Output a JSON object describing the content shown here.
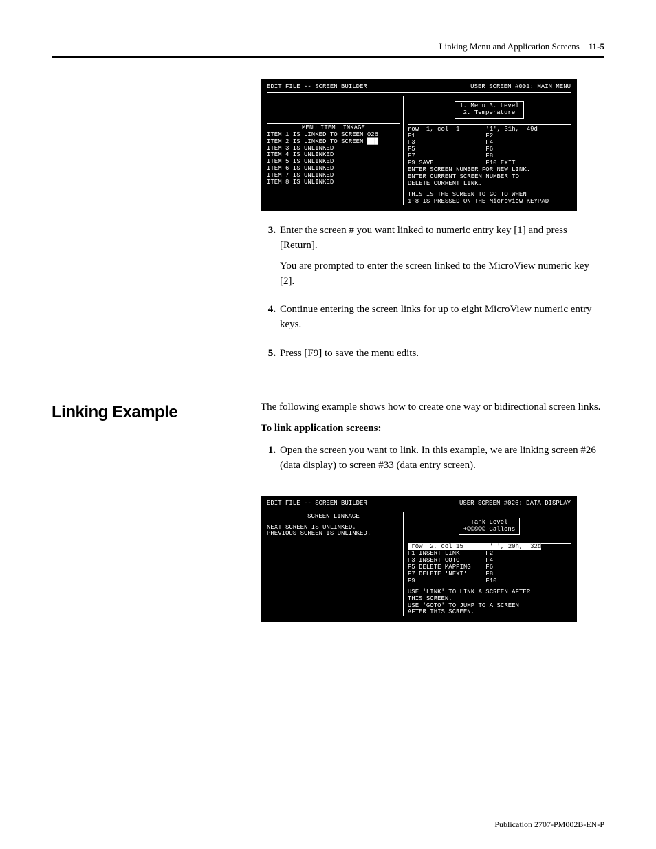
{
  "header": {
    "title": "Linking Menu and Application Screens",
    "page_ref": "11-5"
  },
  "terminal1": {
    "title_left": "EDIT FILE -- SCREEN BUILDER",
    "title_right": "USER SCREEN #001: MAIN MENU",
    "box_l1": "1. Menu 3. Level",
    "box_l2": "2. Temperature",
    "left_heading": "MENU ITEM LINKAGE",
    "left_lines": "ITEM 1 IS LINKED TO SCREEN 026\nITEM 2 IS LINKED TO SCREEN ███\nITEM 3 IS UNLINKED\nITEM 4 IS UNLINKED\nITEM 5 IS UNLINKED\nITEM 6 IS UNLINKED\nITEM 7 IS UNLINKED\nITEM 8 IS UNLINKED",
    "right_status": "row  1, col  1       '1', 31h,  49d",
    "right_fkeys": "F1                   F2\nF3                   F4\nF5                   F6\nF7                   F8\nF9 SAVE              F10 EXIT",
    "right_msg1": "ENTER SCREEN NUMBER FOR NEW LINK.\nENTER CURRENT SCREEN NUMBER TO\nDELETE CURRENT LINK.",
    "right_msg2": "THIS IS THE SCREEN TO GO TO WHEN\n1-8 IS PRESSED ON THE MicroView KEYPAD"
  },
  "steps_a": {
    "s3_num": "3.",
    "s3_p1": "Enter the screen # you want linked to numeric entry key [1] and press [Return].",
    "s3_p2": "You are prompted to enter the screen linked to the MicroView numeric key [2].",
    "s4_num": "4.",
    "s4_p1": "Continue entering the screen links for up to eight MicroView numeric entry keys.",
    "s5_num": "5.",
    "s5_p1": "Press [F9] to save the menu edits."
  },
  "section": {
    "heading": "Linking Example",
    "intro": "The following example shows how to create one way or bidirectional screen links.",
    "subhead": "To link application screens:",
    "s1_num": "1.",
    "s1_p1": "Open the screen you want to link. In this example, we are linking screen #26 (data display) to screen #33 (data entry screen)."
  },
  "terminal2": {
    "title_left": "EDIT FILE -- SCREEN BUILDER",
    "title_right": "USER SCREEN #026: DATA DISPLAY",
    "left_heading": "SCREEN LINKAGE",
    "left_lines": "NEXT SCREEN IS UNLINKED.\nPREVIOUS SCREEN IS UNLINKED.",
    "box_l1": "Tank Level",
    "box_l2": "+©©©©© Gallons",
    "right_status": " row  2, col 15       ' ', 20h,  32d",
    "right_fkeys": "F1 INSERT LINK       F2\nF3 INSERT GOTO       F4\nF5 DELETE MAPPING    F6\nF7 DELETE 'NEXT'     F8\nF9                   F10",
    "right_msg1": "USE 'LINK' TO LINK A SCREEN AFTER\nTHIS SCREEN.\nUSE 'GOTO' TO JUMP TO A SCREEN\nAFTER THIS SCREEN."
  },
  "footer": {
    "pub": "Publication 2707-PM002B-EN-P"
  }
}
